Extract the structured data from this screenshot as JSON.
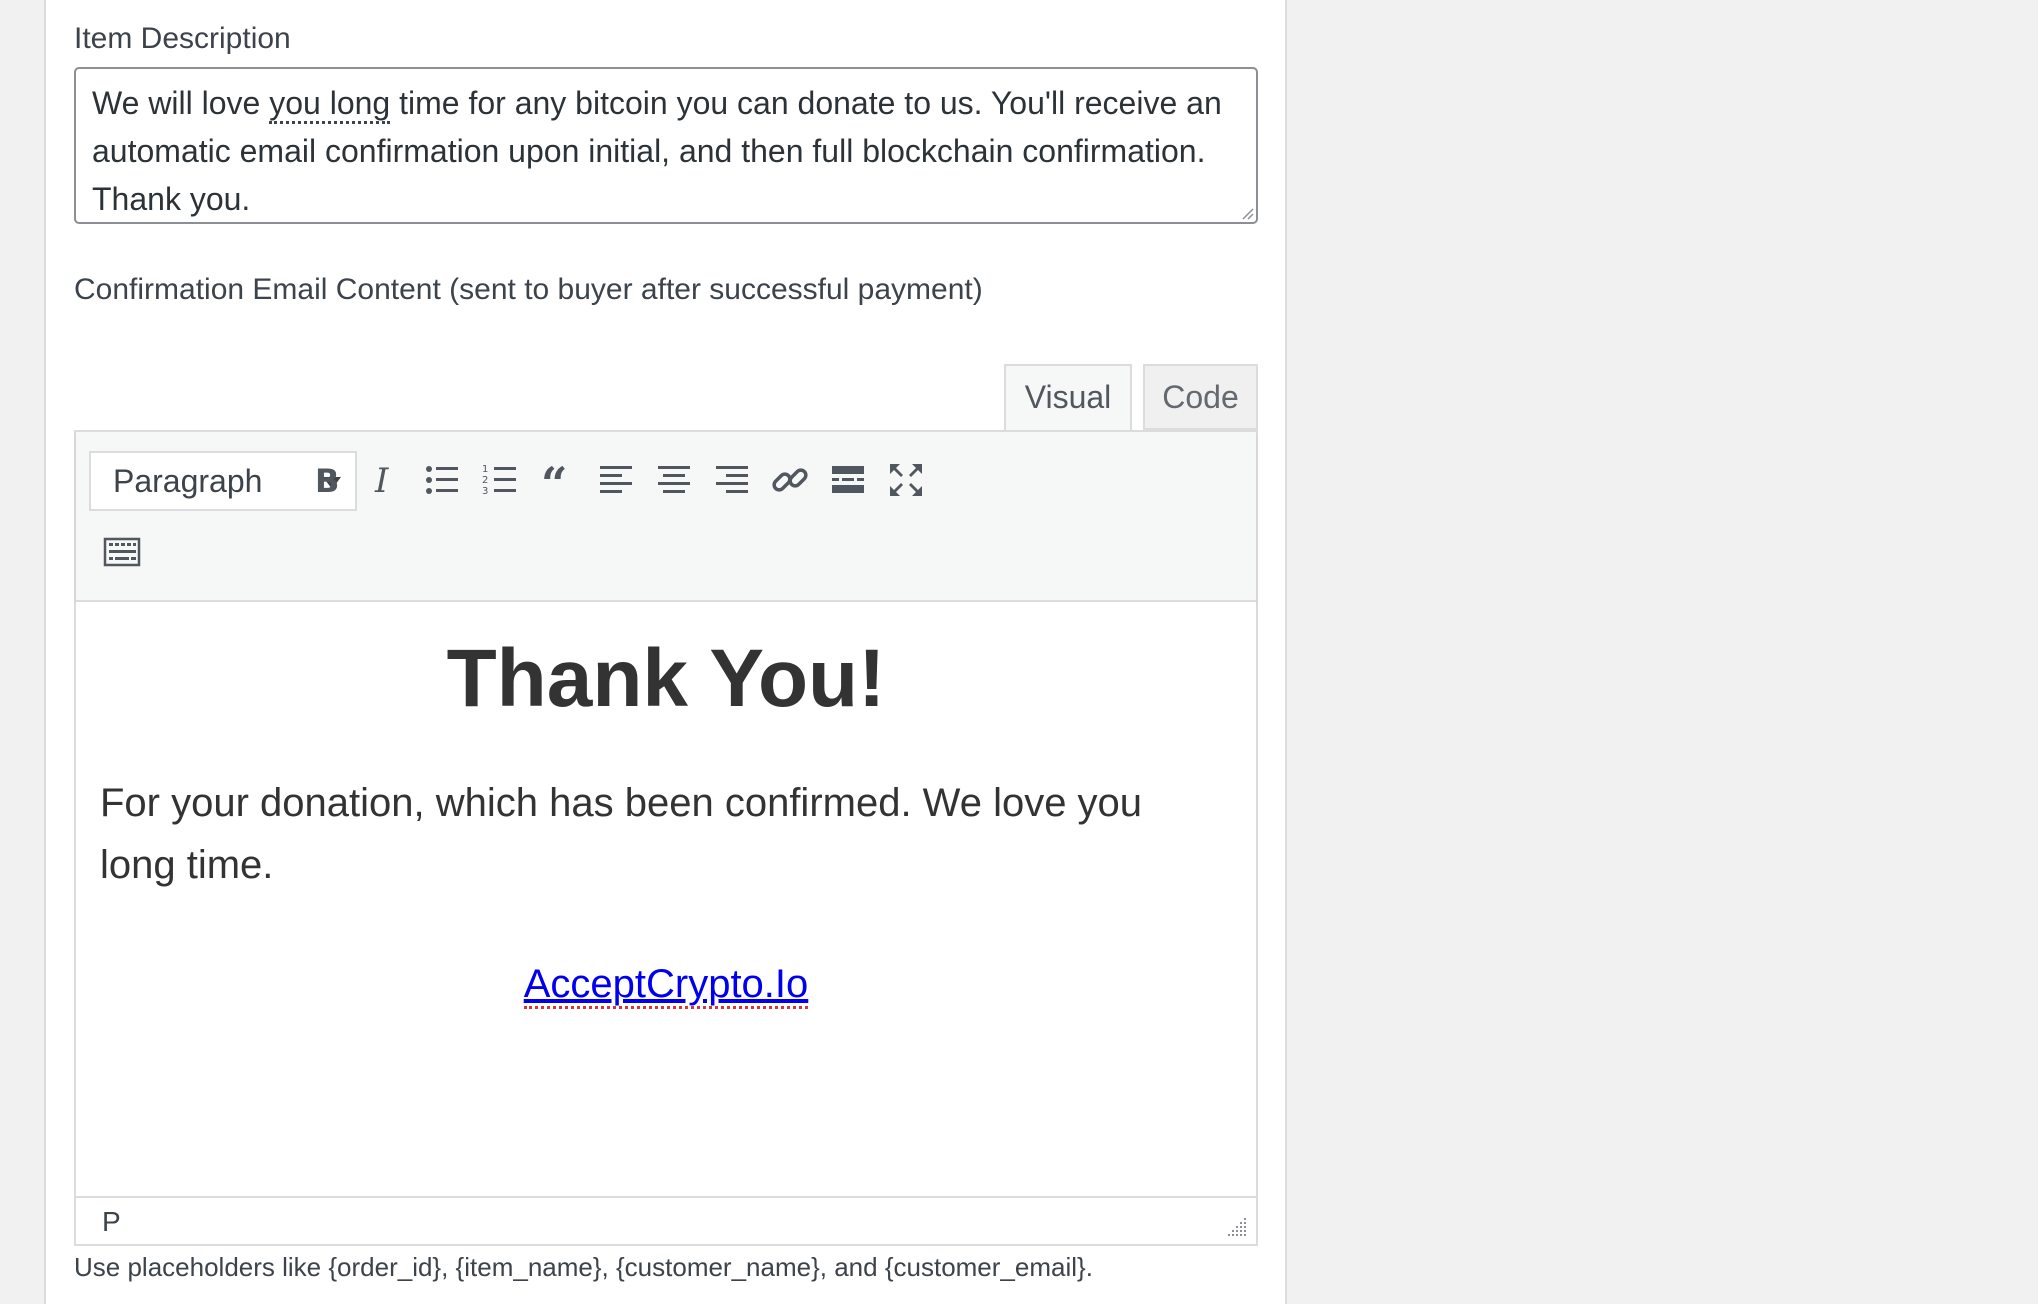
{
  "item_description": {
    "label": "Item Description",
    "value_before": "We will love ",
    "value_marked": "you long",
    "value_after": " time for any bitcoin you can donate to us. You'll receive an automatic email confirmation upon initial, and then full blockchain confirmation. Thank you."
  },
  "confirmation_email": {
    "label": "Confirmation Email Content (sent to buyer after successful payment)",
    "tabs": [
      {
        "label": "Visual",
        "active": true
      },
      {
        "label": "Code",
        "active": false
      }
    ],
    "toolbar": {
      "format_select": "Paragraph",
      "buttons": [
        {
          "name": "bold-icon"
        },
        {
          "name": "italic-icon"
        },
        {
          "name": "bullet-list-icon"
        },
        {
          "name": "numbered-list-icon"
        },
        {
          "name": "blockquote-icon"
        },
        {
          "name": "align-left-icon"
        },
        {
          "name": "align-center-icon"
        },
        {
          "name": "align-right-icon"
        },
        {
          "name": "link-icon"
        },
        {
          "name": "read-more-icon"
        },
        {
          "name": "fullscreen-icon"
        },
        {
          "name": "toolbar-toggle-icon"
        }
      ]
    },
    "content": {
      "heading": "Thank You!",
      "paragraph": "For your donation, which has been confirmed. We love you long time.",
      "link_text": "AcceptCrypto.Io"
    },
    "status_path": "P",
    "hint": "Use placeholders like {order_id}, {item_name}, {customer_name}, and {customer_email}."
  },
  "colors": {
    "link": "#0000ee",
    "text": "#3c434a",
    "border": "#dcdcde",
    "toolbar_bg": "#f6f7f7"
  }
}
